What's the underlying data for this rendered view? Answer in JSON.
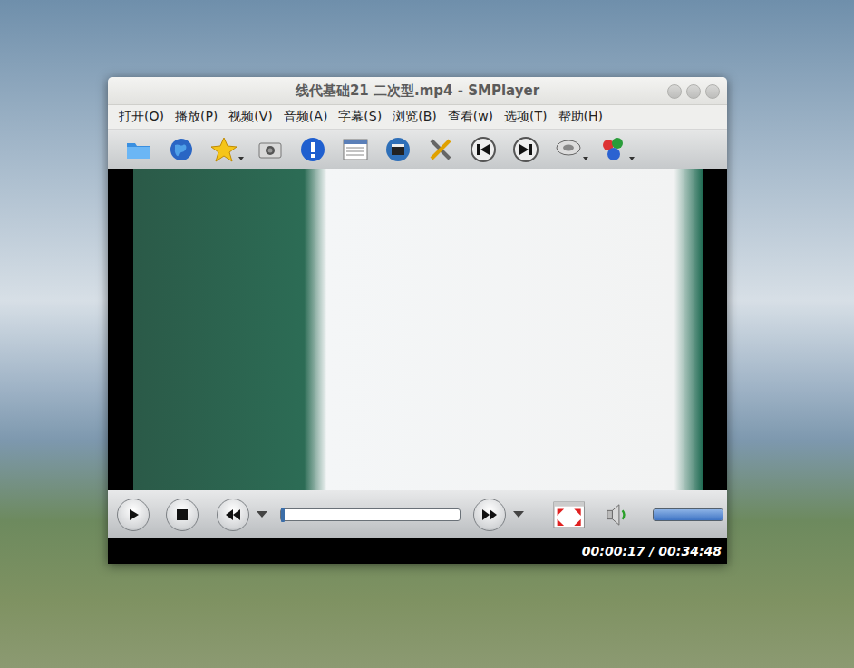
{
  "window": {
    "title": "线代基础21 二次型.mp4 - SMPlayer"
  },
  "menu": [
    "打开(O)",
    "播放(P)",
    "视频(V)",
    "音频(A)",
    "字幕(S)",
    "浏览(B)",
    "查看(w)",
    "选项(T)",
    "帮助(H)"
  ],
  "toolbar": [
    {
      "kind": "open",
      "menu": false
    },
    {
      "kind": "url",
      "menu": false
    },
    {
      "kind": "favorites",
      "menu": true
    },
    {
      "kind": "screenshot",
      "menu": false
    },
    {
      "kind": "info",
      "menu": false
    },
    {
      "kind": "playlist",
      "menu": false
    },
    {
      "kind": "video",
      "menu": false
    },
    {
      "kind": "preferences",
      "menu": false
    },
    {
      "kind": "previous",
      "menu": false
    },
    {
      "kind": "next",
      "menu": false
    },
    {
      "kind": "audio",
      "menu": true
    },
    {
      "kind": "subtitles",
      "menu": true
    }
  ],
  "controls": {
    "playing": false,
    "seek_level": 0.01,
    "volume_level": 1.0
  },
  "status_bar": {
    "time": "00:00:17 / 00:34:48"
  }
}
